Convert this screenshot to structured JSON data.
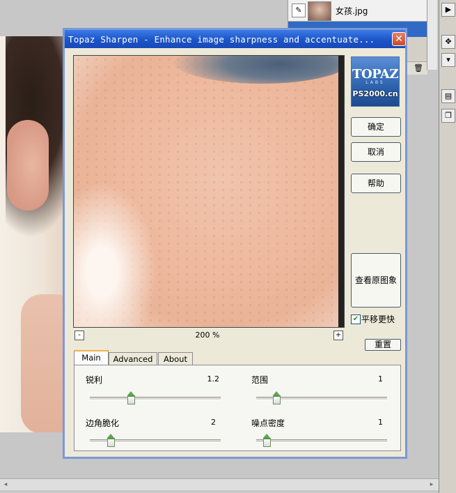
{
  "dialog": {
    "title": "Topaz Sharpen - Enhance image sharpness and accentuate...",
    "close_glyph": "✕",
    "zoom": {
      "minus": "-",
      "plus": "+",
      "label": "200 %"
    }
  },
  "logo": {
    "line1": "TOPAZ",
    "line2": "LABS",
    "line3": "PS2000.cn"
  },
  "buttons": {
    "ok": "确定",
    "cancel": "取消",
    "help": "帮助",
    "view_original": "查看原图象",
    "reset": "重置"
  },
  "pan_checkbox": {
    "label": "平移更快",
    "checked": true,
    "glyph": "✔"
  },
  "tabs": [
    {
      "label": "Main",
      "active": true
    },
    {
      "label": "Advanced",
      "active": false
    },
    {
      "label": "About",
      "active": false
    }
  ],
  "params": {
    "sharpen": {
      "label": "锐利",
      "value": "1.2"
    },
    "radius": {
      "label": "范围",
      "value": "1"
    },
    "edge_sharpness": {
      "label": "边角脆化",
      "value": "2"
    },
    "noise_density": {
      "label": "噪点密度",
      "value": "1"
    }
  },
  "layers": {
    "name": "女孩.jpg",
    "eye_glyph": "✎",
    "trash_glyph": "🗑"
  },
  "icons": {
    "close": "close-icon",
    "zoom_out": "minus-icon",
    "zoom_in": "plus-icon",
    "eye": "visibility-icon",
    "trash": "trash-icon"
  },
  "colors": {
    "titlebar": "#1b55c8",
    "slider_accent": "#3fa23f",
    "tab_highlight": "#f1b24a"
  }
}
